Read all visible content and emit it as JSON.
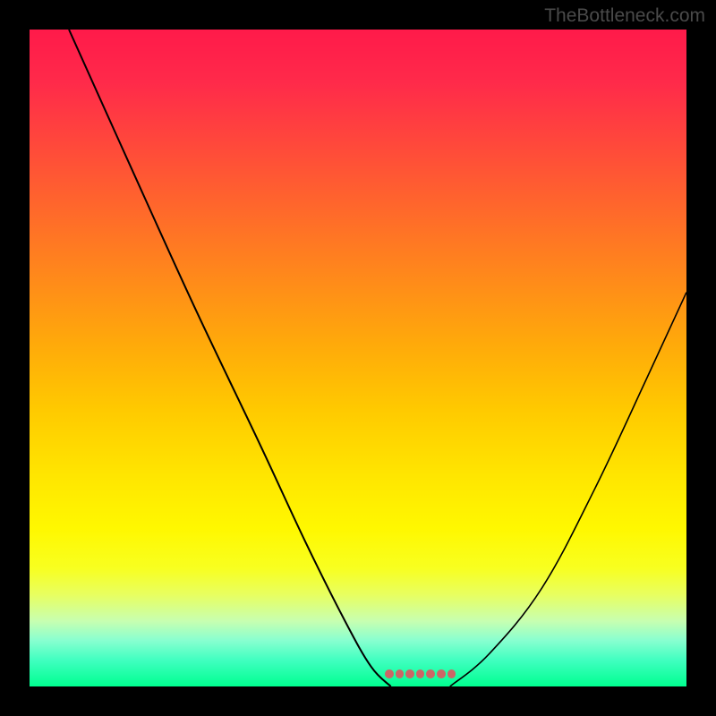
{
  "watermark": "TheBottleneck.com",
  "chart_data": {
    "type": "line",
    "title": "",
    "xlabel": "",
    "ylabel": "",
    "xlim": [
      0,
      100
    ],
    "ylim": [
      0,
      100
    ],
    "background_gradient": {
      "top_color": "#ff1a4a",
      "mid_color": "#ffe600",
      "bottom_color": "#00ff90",
      "description": "vertical red-orange-yellow-green gradient; green at bottom indicates optimal zone"
    },
    "series": [
      {
        "name": "left-curve",
        "x": [
          6,
          15,
          25,
          35,
          42,
          48,
          52,
          55
        ],
        "y": [
          100,
          80,
          58,
          37,
          22,
          10,
          3,
          0
        ],
        "stroke": "#000000"
      },
      {
        "name": "right-curve",
        "x": [
          64,
          70,
          78,
          86,
          94,
          100
        ],
        "y": [
          0,
          5,
          15,
          30,
          47,
          60
        ],
        "stroke": "#000000"
      }
    ],
    "optimal_range": {
      "x_start": 54,
      "x_end": 65,
      "color": "#cc6666",
      "description": "flat band of markers near y=0 indicating the optimal / no-bottleneck region"
    },
    "grid": false,
    "legend": false
  }
}
